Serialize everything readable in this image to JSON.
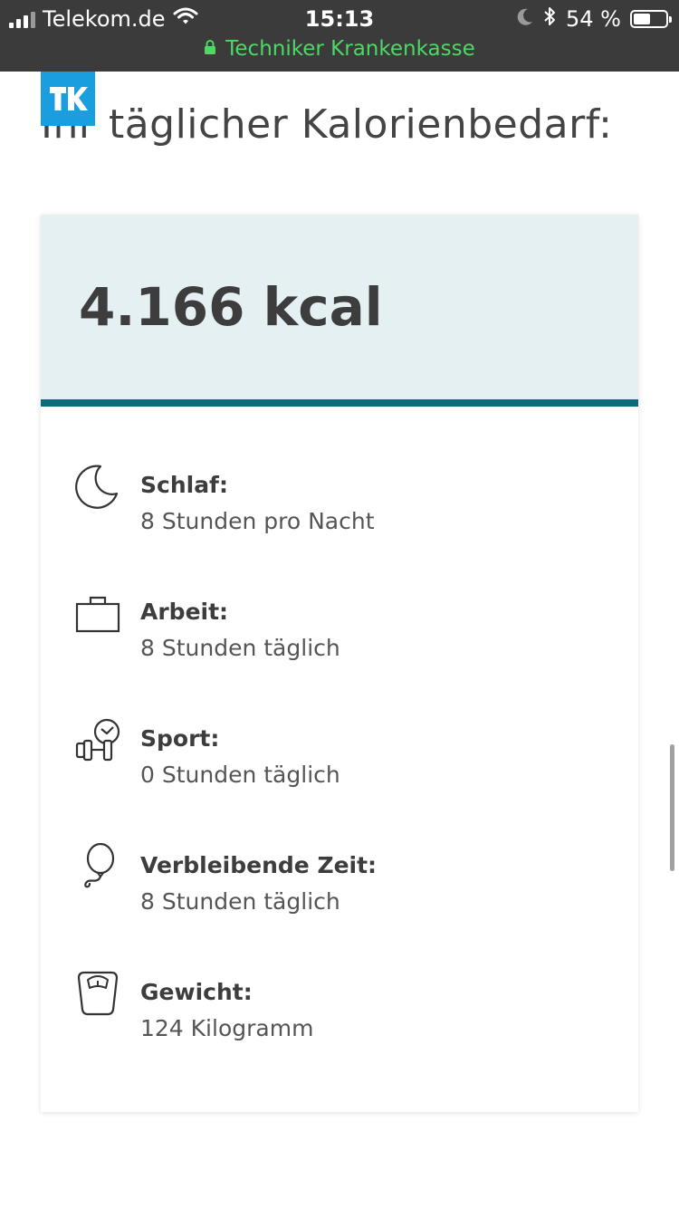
{
  "statusbar": {
    "carrier": "Telekom.de",
    "time": "15:13",
    "battery_text": "54 %",
    "battery_level": 0.54,
    "signal_bars": 3,
    "url": "Techniker Krankenkasse"
  },
  "logo": {
    "text": "TK",
    "color": "#1a9ee0"
  },
  "page": {
    "heading": "Ihr täglicher Kalorienbedarf:"
  },
  "result": {
    "value": "4.166 kcal"
  },
  "details": [
    {
      "icon": "moon-icon",
      "label": "Schlaf:",
      "value": "8 Stunden pro Nacht"
    },
    {
      "icon": "briefcase-icon",
      "label": "Arbeit:",
      "value": "8 Stunden täglich"
    },
    {
      "icon": "dumbbell-clock-icon",
      "label": "Sport:",
      "value": "0 Stunden täglich"
    },
    {
      "icon": "balloon-icon",
      "label": "Verbleibende Zeit:",
      "value": "8 Stunden täglich"
    },
    {
      "icon": "scale-icon",
      "label": "Gewicht:",
      "value": "124 Kilogramm"
    }
  ],
  "colors": {
    "accent": "#0c6a7d",
    "result_bg": "#e4f0f2",
    "url_green": "#4cd964"
  }
}
